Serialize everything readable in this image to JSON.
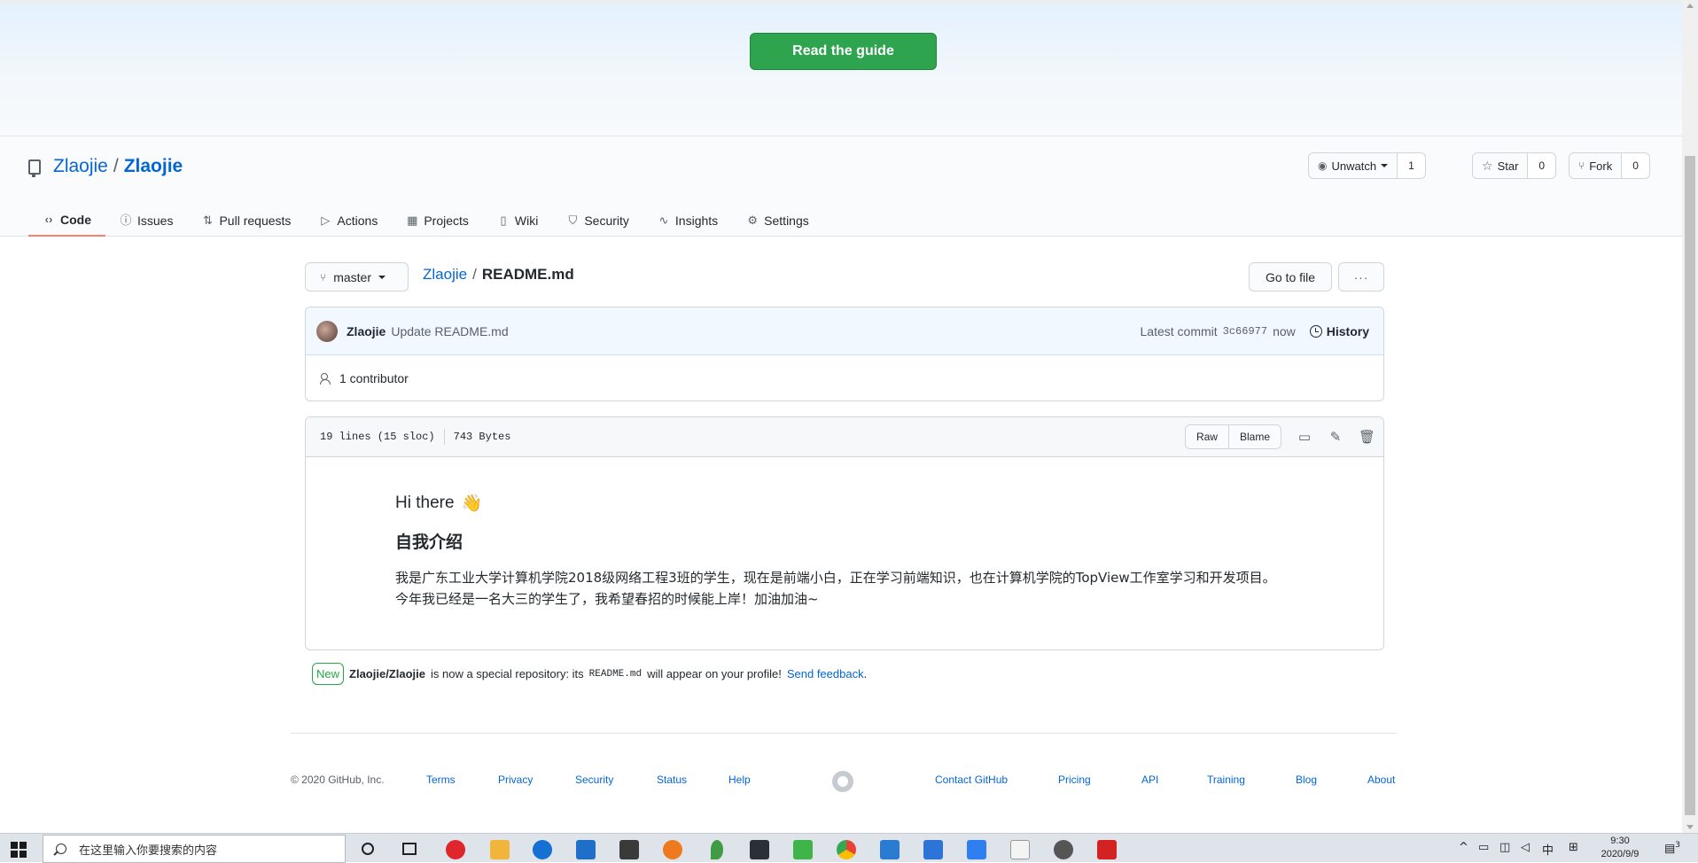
{
  "banner": {
    "guide_button": "Read the guide"
  },
  "repo": {
    "owner": "Zlaojie",
    "separator": "/",
    "name": "Zlaojie",
    "watch_label": "Unwatch",
    "watch_count": "1",
    "star_label": "Star",
    "star_count": "0",
    "fork_label": "Fork",
    "fork_count": "0"
  },
  "tabs": [
    {
      "label": "Code",
      "icon": "code-icon"
    },
    {
      "label": "Issues",
      "icon": "issue-icon"
    },
    {
      "label": "Pull requests",
      "icon": "pull-request-icon"
    },
    {
      "label": "Actions",
      "icon": "play-icon"
    },
    {
      "label": "Projects",
      "icon": "project-icon"
    },
    {
      "label": "Wiki",
      "icon": "book-icon"
    },
    {
      "label": "Security",
      "icon": "shield-icon"
    },
    {
      "label": "Insights",
      "icon": "graph-icon"
    },
    {
      "label": "Settings",
      "icon": "gear-icon"
    }
  ],
  "file_nav": {
    "branch": "master",
    "crumb_repo": "Zlaojie",
    "crumb_sep": "/",
    "crumb_file": "README.md",
    "goto_label": "Go to file",
    "more_label": "···"
  },
  "commit": {
    "author": "Zlaojie",
    "message": "Update README.md",
    "latest_label": "Latest commit",
    "sha": "3c66977",
    "time": "now",
    "history_label": "History",
    "contributors": "1 contributor"
  },
  "file": {
    "lines": "19 lines (15 sloc)",
    "size": "743 Bytes",
    "raw_label": "Raw",
    "blame_label": "Blame"
  },
  "readme": {
    "heading": "Hi there",
    "wave": "👋",
    "subheading": "自我介绍",
    "paragraph": "我是广东工业大学计算机学院2018级网络工程3班的学生，现在是前端小白，正在学习前端知识，也在计算机学院的TopView工作室学习和开发项目。今年我已经是一名大三的学生了，我希望春招的时候能上岸！加油加油~"
  },
  "notice": {
    "badge": "New",
    "repo": "Zlaojie/Zlaojie",
    "text1": "is now a special repository: its",
    "code": "README.md",
    "text2": "will appear on your profile!",
    "link": "Send feedback",
    "end": "."
  },
  "footer": {
    "copyright": "© 2020 GitHub, Inc.",
    "links_left": [
      "Terms",
      "Privacy",
      "Security",
      "Status",
      "Help"
    ],
    "links_right": [
      "Contact GitHub",
      "Pricing",
      "API",
      "Training",
      "Blog",
      "About"
    ]
  },
  "taskbar": {
    "search_placeholder": "在这里输入你要搜索的内容",
    "tray_ime": "中",
    "time": "9:30",
    "date": "2020/9/9",
    "notifications": "3"
  },
  "colors": {
    "accent": "#0366d6",
    "primary_button": "#2ea44f",
    "tab_underline": "#f9826c"
  }
}
